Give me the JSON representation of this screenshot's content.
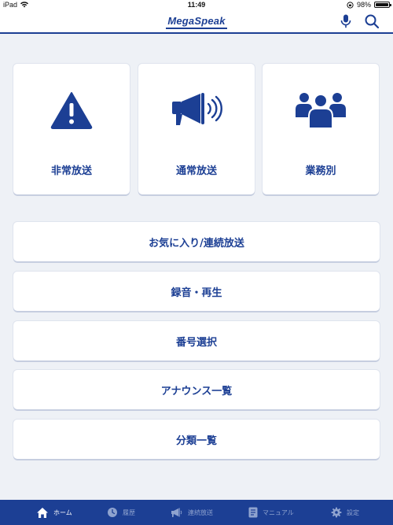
{
  "status_bar": {
    "device": "iPad",
    "time": "11:49",
    "battery": "98%",
    "battery_level": 0.98
  },
  "nav": {
    "logo": "MegaSpeak"
  },
  "cards": [
    {
      "label": "非常放送",
      "icon": "warning-icon"
    },
    {
      "label": "通常放送",
      "icon": "megaphone-icon"
    },
    {
      "label": "業務別",
      "icon": "people-group-icon"
    }
  ],
  "menu": [
    "お気に入り/連続放送",
    "録音・再生",
    "番号選択",
    "アナウンス一覧",
    "分類一覧"
  ],
  "tabs": [
    {
      "label": "ホーム",
      "icon": "home-icon",
      "active": true
    },
    {
      "label": "履歴",
      "icon": "clock-icon",
      "active": false
    },
    {
      "label": "連続放送",
      "icon": "megaphone-icon",
      "active": false
    },
    {
      "label": "マニュアル",
      "icon": "document-icon",
      "active": false
    },
    {
      "label": "設定",
      "icon": "gear-icon",
      "active": false
    }
  ],
  "colors": {
    "brand": "#1c3f94",
    "background": "#eef1f6",
    "card": "#ffffff",
    "tab_inactive": "#8fa3cf"
  }
}
